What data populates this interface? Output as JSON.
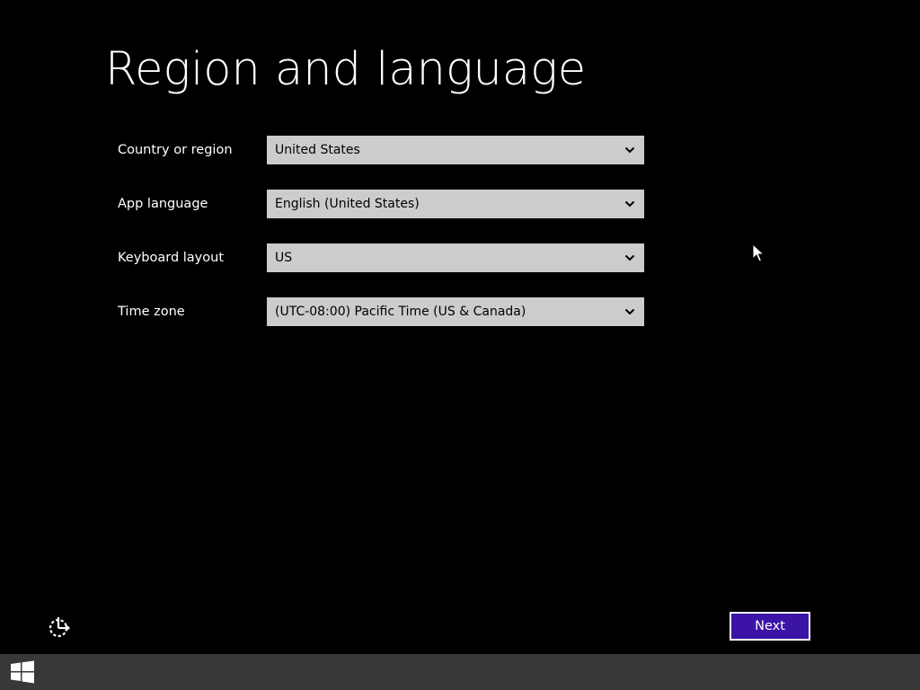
{
  "page": {
    "title": "Region and language"
  },
  "form": {
    "fields": [
      {
        "label": "Country or region",
        "value": "United States"
      },
      {
        "label": "App language",
        "value": "English (United States)"
      },
      {
        "label": "Keyboard layout",
        "value": "US"
      },
      {
        "label": "Time zone",
        "value": "(UTC-08:00) Pacific Time (US & Canada)"
      }
    ]
  },
  "footer": {
    "next_label": "Next",
    "accessibility_icon": "ease-of-access-icon"
  },
  "taskbar": {
    "start_icon": "windows-logo-icon"
  },
  "colors": {
    "background": "#000000",
    "dropdown": "#cccccc",
    "accent": "#3b14a7",
    "taskbar": "#383838"
  }
}
